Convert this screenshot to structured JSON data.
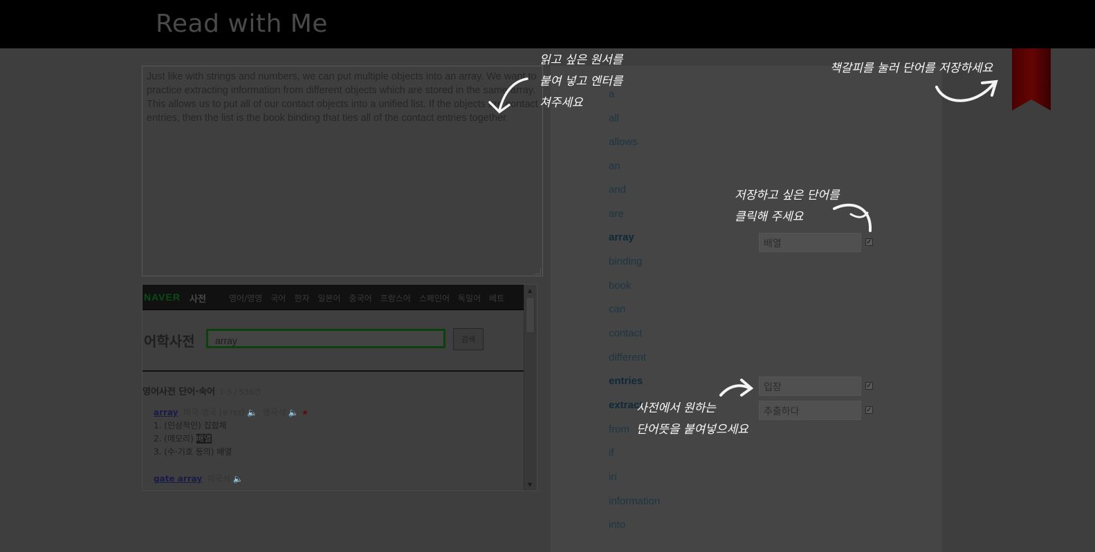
{
  "app": {
    "title": "Read with Me"
  },
  "document": {
    "paragraphs": [
      "Just like with strings and numbers, we can put multiple objects into an array. We want to practice extracting information from different objects which are stored in the same array.",
      "This allows us to put all of our contact objects into a unified list. If the objects are contact entries, then the list is the book binding that ties all of the contact entries together"
    ]
  },
  "dictionary": {
    "brand": "NAVER",
    "brand_sub": "사전",
    "nav": [
      "영어/영영",
      "국어",
      "한자",
      "일본어",
      "중국어",
      "프랑스어",
      "스페인어",
      "독일어",
      "베트"
    ],
    "title": "어학사전",
    "search_value": "array",
    "search_button": "검색",
    "section": "영어사전 단어·숙어",
    "count": "1-5 / 536건",
    "entries": [
      {
        "head": "array",
        "region": "미국·영국 [əˈreɪ]",
        "alt": "영국식",
        "senses": [
          "1. (인상적인) 집합체",
          "2. (메모리) ",
          "3. (수·기호 등의) 배열"
        ],
        "highlight": "배열"
      },
      {
        "head": "gate array",
        "region": "미국식",
        "senses": []
      }
    ]
  },
  "words": [
    "a",
    "all",
    "allows",
    "an",
    "and",
    "are",
    "array",
    "binding",
    "book",
    "can",
    "contact",
    "different",
    "entries",
    "extract",
    "from",
    "if",
    "in",
    "information",
    "into"
  ],
  "selected_words": [
    "array",
    "entries",
    "extract"
  ],
  "meanings": [
    {
      "word": "array",
      "value": "배열",
      "checked": true
    },
    {
      "word": "entries",
      "value": "입장",
      "checked": true
    },
    {
      "word": "extract",
      "value": "추출하다",
      "checked": true
    }
  ],
  "tips": {
    "paste": "읽고 싶은 원서를\n붙여 넣고 엔터를\n쳐주세요",
    "bookmark": "책갈피를 눌러 단어를 저장하세요",
    "click_word": "저장하고 싶은 단어를\n클릭해 주세요",
    "dictionary": "사전에서 원하는\n단어뜻을 붙여넣으세요"
  },
  "colors": {
    "overlay_bg": "#3e3e3e",
    "topbar": "#000000",
    "bookmark": "#5a0000",
    "tip_text": "#fafafa"
  },
  "icons": [
    "bookmark-icon",
    "speaker-icon",
    "star-icon",
    "checkbox-icon"
  ]
}
